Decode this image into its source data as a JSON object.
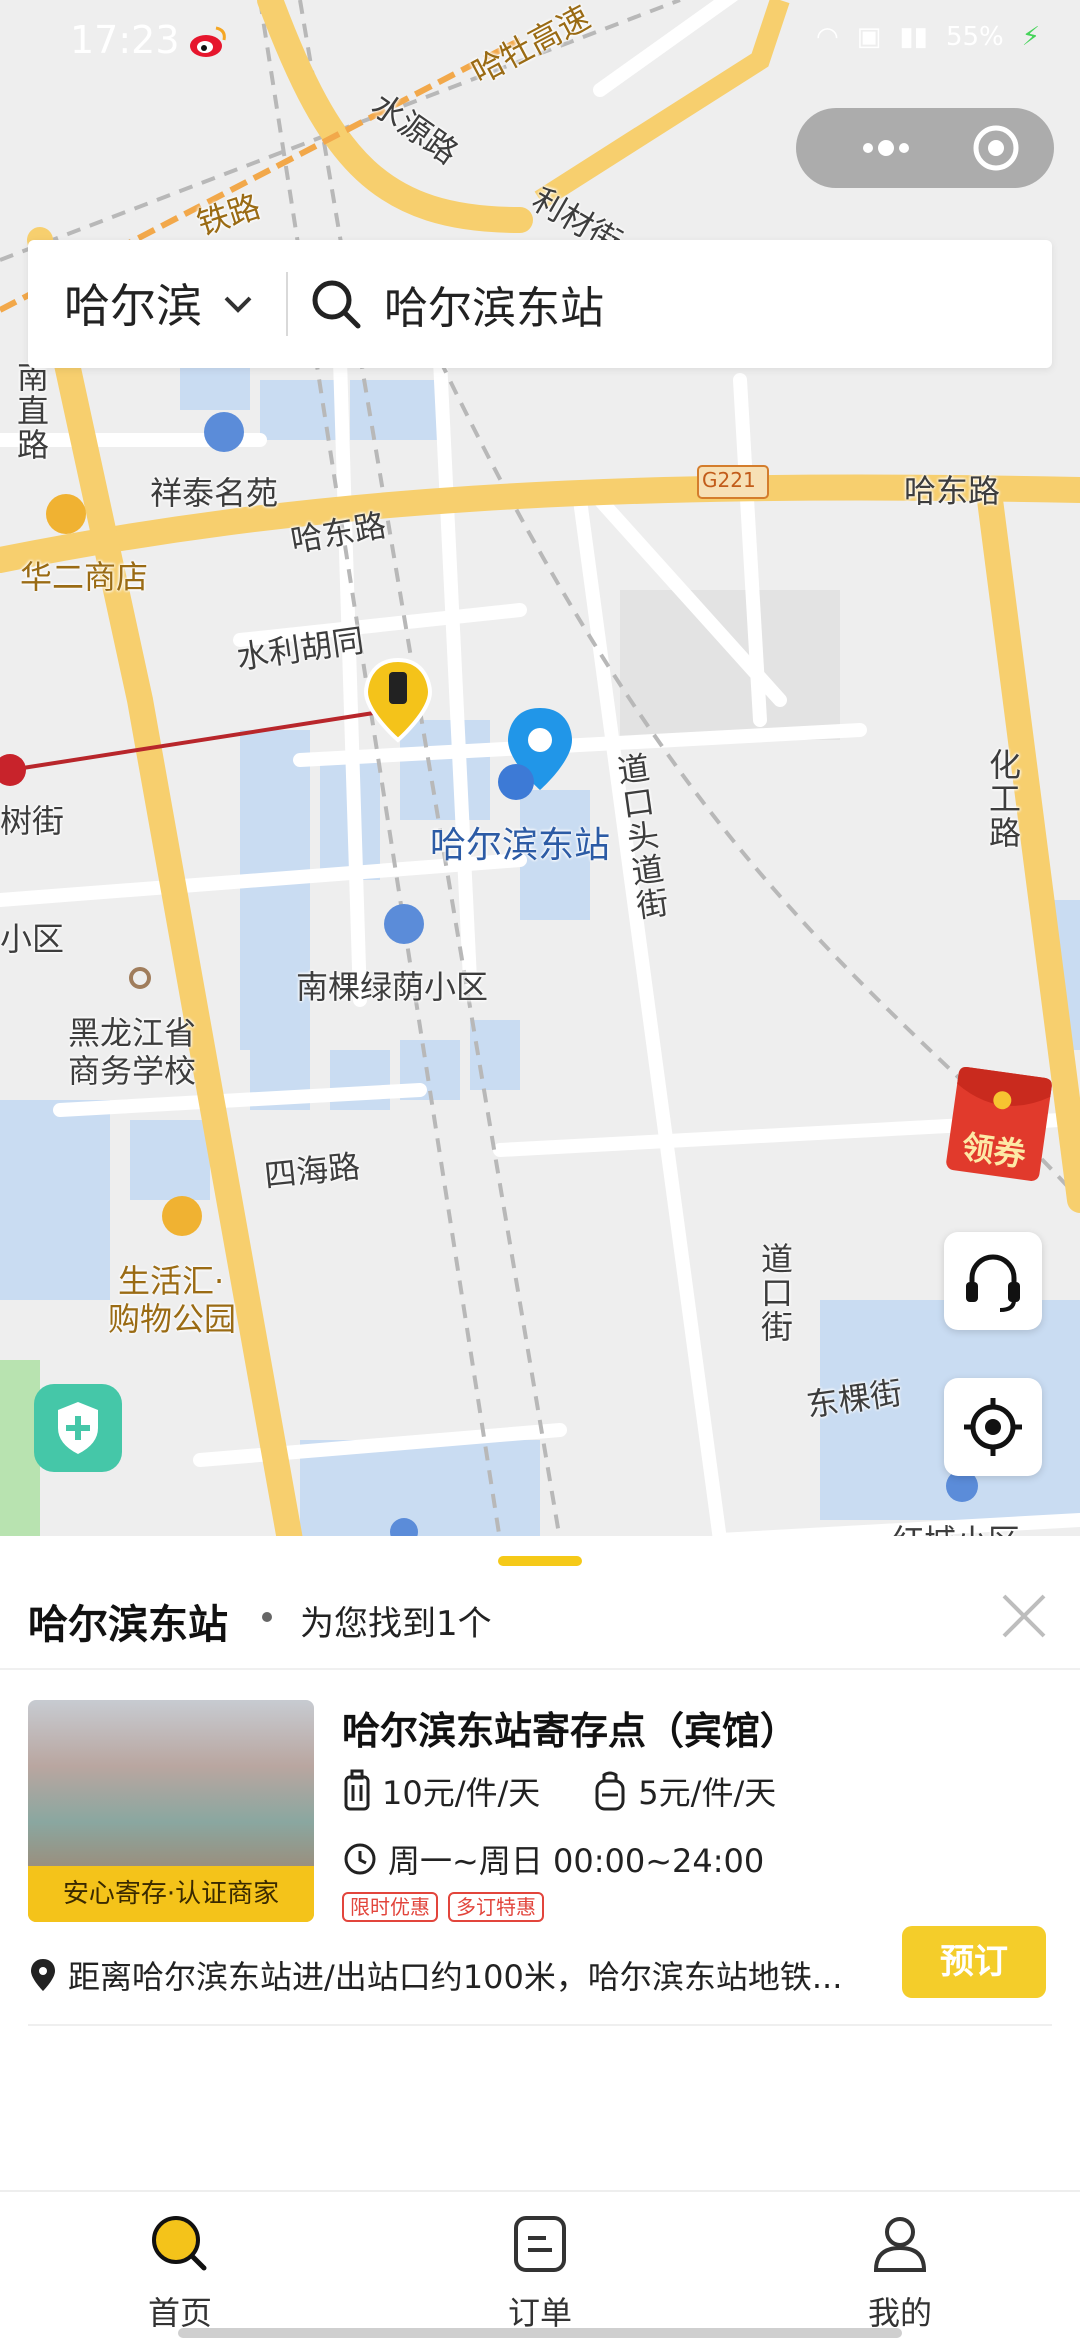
{
  "status_bar": {
    "time": "17:23",
    "battery": "55%"
  },
  "search": {
    "city": "哈尔滨",
    "query": "哈尔滨东站"
  },
  "map": {
    "labels": {
      "harbin_expressway": "哈牡高速",
      "railway": "铁路",
      "shuiyuan": "水源路",
      "licai": "利材街",
      "nanzhi": "南直路",
      "xiangtai": "祥泰名苑",
      "hadong_left": "哈东路",
      "hadong_right": "哈东路",
      "g221": "G221",
      "huaer": "华二商店",
      "shuili": "水利胡同",
      "shu_street": "树街",
      "xiaoqu": "小区",
      "station": "哈尔滨东站",
      "daokou_toudao": "道口头道街",
      "huagong": "化工路",
      "nanke": "南棵绿荫小区",
      "heilongjiang": "黑龙江省",
      "business_school": "商务学校",
      "sihai": "四海路",
      "daokou": "道口街",
      "shenghuohui": "生活汇·",
      "park": "购物公园",
      "dongke": "东棵街",
      "hongcheng": "红城小区"
    },
    "coupon_label": "领券"
  },
  "sheet": {
    "title": "哈尔滨东站",
    "result_text": "为您找到1个",
    "item": {
      "badge": "安心寄存·认证商家",
      "name": "哈尔滨东站寄存点（宾馆）",
      "price_luggage": "10元/件/天",
      "price_bag": "5元/件/天",
      "hours": "周一~周日 00:00~24:00",
      "tags": [
        "限时优惠",
        "多订特惠"
      ],
      "address": "距离哈尔滨东站进/出站口约100米，哈尔滨东站地铁...",
      "book_label": "预订"
    }
  },
  "tabbar": {
    "tabs": [
      {
        "label": "首页"
      },
      {
        "label": "订单"
      },
      {
        "label": "我的"
      }
    ]
  },
  "colors": {
    "accent": "#f4c31a",
    "road": "#f7cf6e",
    "water": "#c9dcf2"
  }
}
